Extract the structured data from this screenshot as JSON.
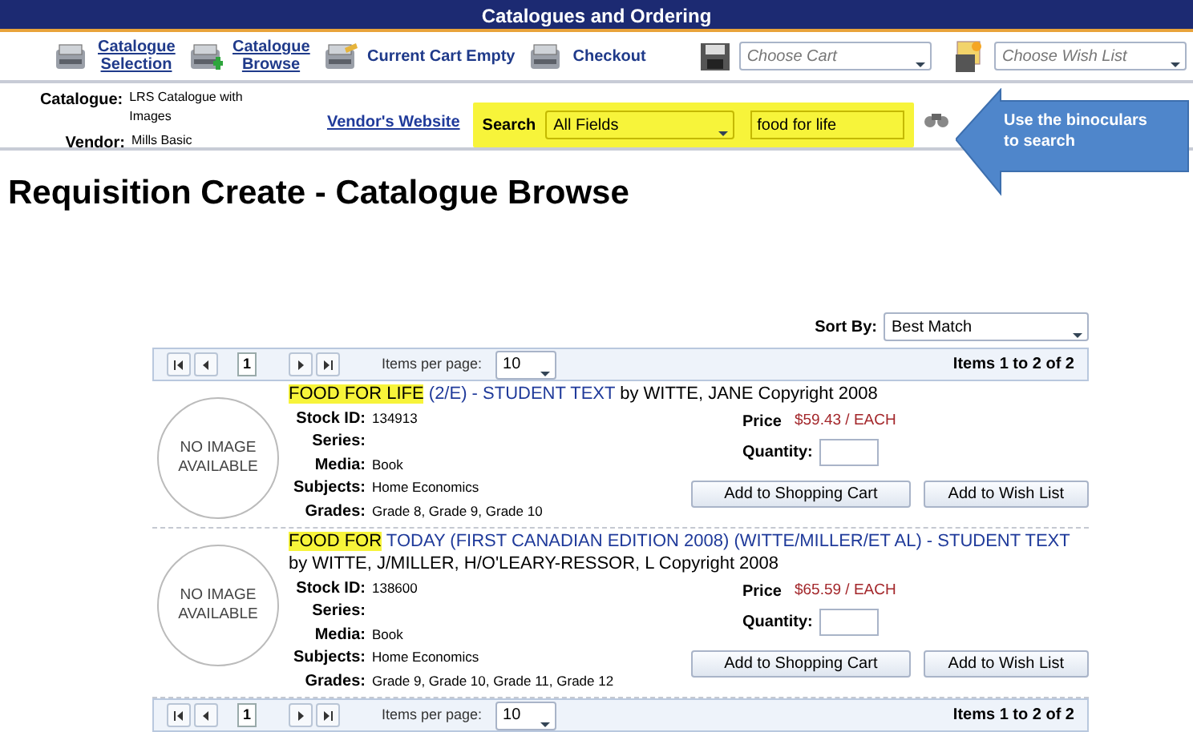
{
  "window": {
    "title": "Catalogues and Ordering"
  },
  "toolbar": [
    {
      "kind": "link",
      "label": "Catalogue Selection"
    },
    {
      "kind": "link",
      "label": "Catalogue Browse"
    },
    {
      "kind": "plain",
      "label": "Current Cart Empty"
    },
    {
      "kind": "plain",
      "label": "Checkout"
    }
  ],
  "cart_select": {
    "placeholder": "Choose Cart"
  },
  "wish_select": {
    "placeholder": "Choose Wish List"
  },
  "info": [
    {
      "label": "Catalogue:",
      "value": "LRS Catalogue with Images"
    },
    {
      "label": "Vendor:",
      "value": "Mills Basic"
    }
  ],
  "vendor_link": "Vendor's Website",
  "search": {
    "label": "Search",
    "field": "All Fields",
    "value": "food for life"
  },
  "callout": "Use the binoculars to  search",
  "heading": "Requisition Create - Catalogue Browse",
  "sort": {
    "label": "Sort By:",
    "value": "Best Match"
  },
  "pager_top": {
    "page": "1",
    "per_page_label": "Items per page:",
    "per_page": "10",
    "summary": "Items 1 to 2 of 2"
  },
  "pager_bottom": {
    "page": "1",
    "per_page_label": "Items per page:",
    "per_page": "10",
    "summary": "Items 1 to 2 of 2"
  },
  "items": [
    {
      "image": "NO IMAGE AVAILABLE",
      "highlight": "FOOD FOR LIFE",
      "title": " (2/E) - STUDENT TEXT",
      "byline": " by WITTE, JANE  Copyright 2008",
      "fields": [
        {
          "label": "Stock ID:",
          "value": "134913"
        },
        {
          "label": "Series:"
        },
        {
          "label": "Media:",
          "value": "Book"
        },
        {
          "label": "Subjects:",
          "value": "Home Economics"
        },
        {
          "label": "Grades:",
          "value": "Grade 8, Grade 9, Grade 10"
        }
      ],
      "price_label": "Price",
      "price": "$59.43",
      "unit": "/ EACH",
      "qty_label": "Quantity:",
      "cart_button": "Add to Shopping Cart",
      "wish_button": "Add to Wish List"
    },
    {
      "image": "NO IMAGE AVAILABLE",
      "highlight": "FOOD FOR",
      "title": " TODAY (FIRST CANADIAN EDITION 2008) (WITTE/MILLER/ET AL) - STUDENT TEXT",
      "byline": " by WITTE, J/MILLER, H/O'LEARY-RESSOR, L  Copyright 2008",
      "fields": [
        {
          "label": "Stock ID:",
          "value": "138600"
        },
        {
          "label": "Series:"
        },
        {
          "label": "Media:",
          "value": "Book"
        },
        {
          "label": "Subjects:",
          "value": "Home Economics"
        },
        {
          "label": "Grades:",
          "value": "Grade 9, Grade 10, Grade 11, Grade 12"
        }
      ],
      "price_label": "Price",
      "price": "$65.59",
      "unit": "/ EACH",
      "qty_label": "Quantity:",
      "cart_button": "Add to Shopping Cart",
      "wish_button": "Add to Wish List"
    }
  ]
}
